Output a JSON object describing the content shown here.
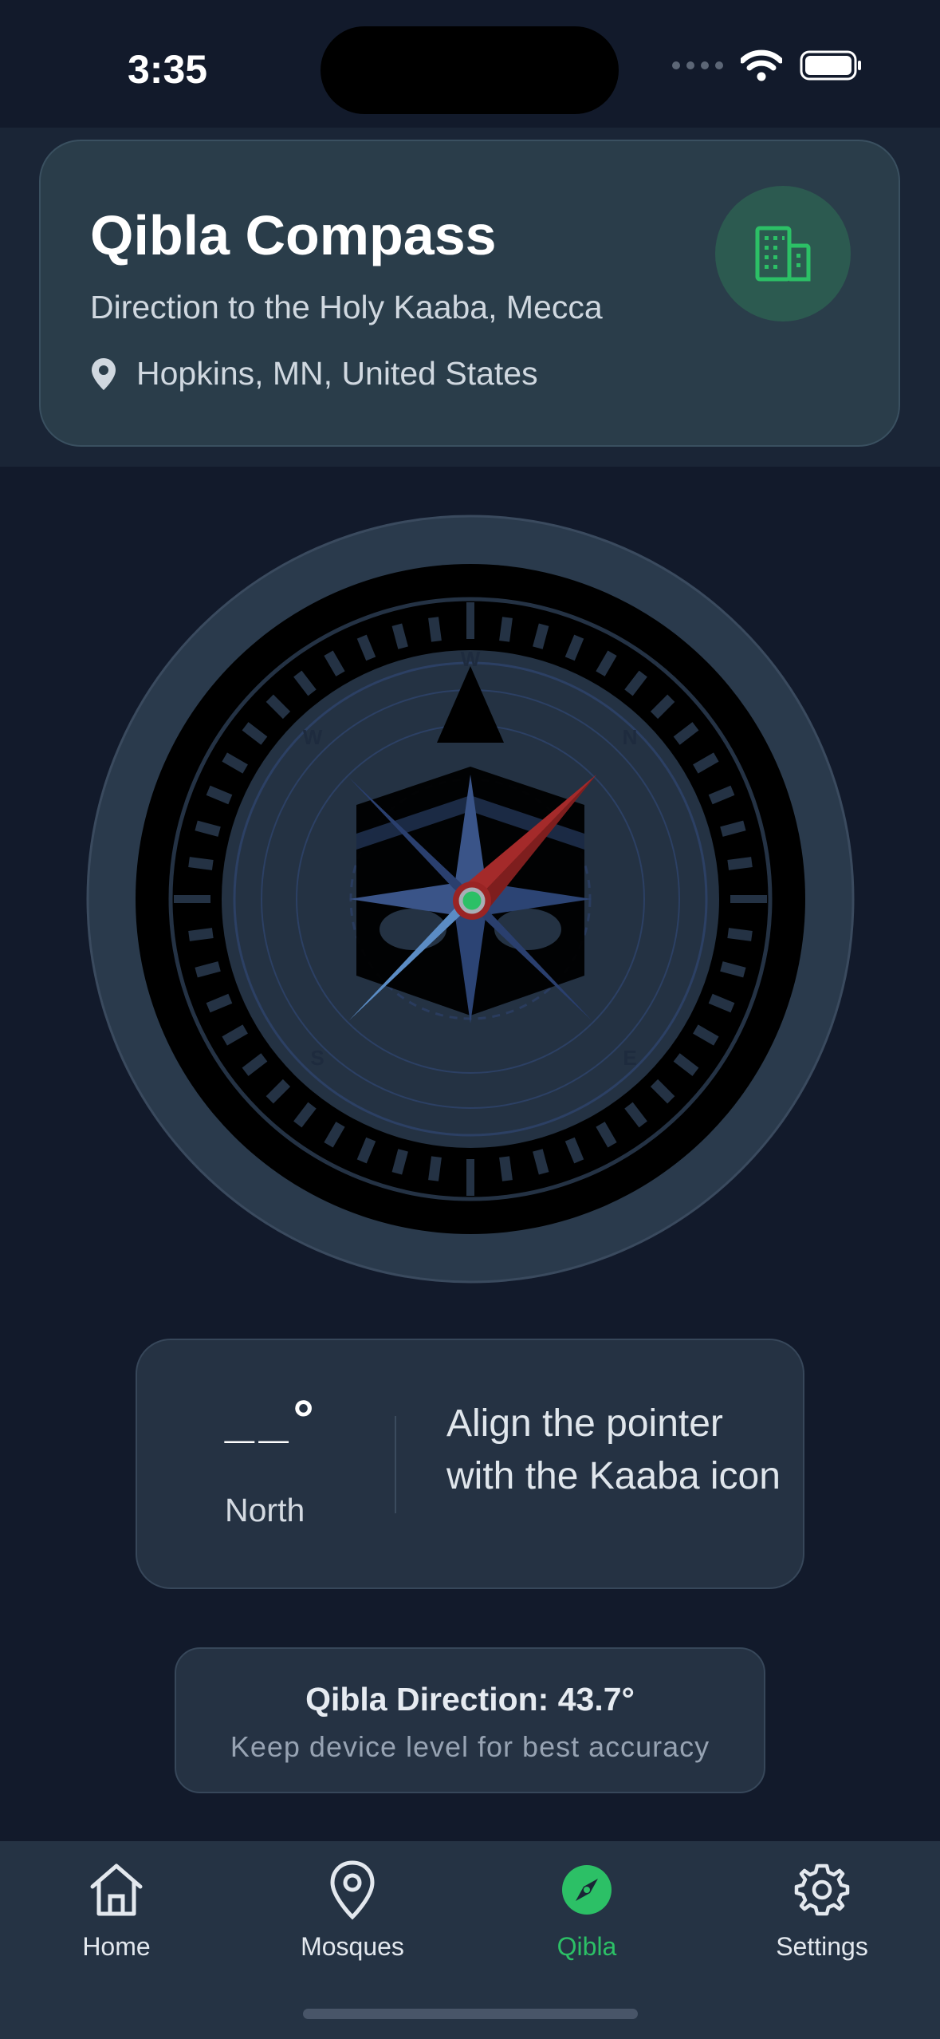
{
  "status_bar": {
    "time": "3:35"
  },
  "header": {
    "title": "Qibla Compass",
    "subtitle": "Direction to the Holy Kaaba, Mecca",
    "location": "Hopkins, MN, United States",
    "badge_icon": "building-icon",
    "accent_color": "#2cc066"
  },
  "compass": {
    "cardinals": {
      "n": "N",
      "e": "E",
      "s": "S",
      "w": "W"
    },
    "needle_color": "#a42a2a",
    "ring_color": "#2a3a4c"
  },
  "info_card": {
    "heading_value": "__°",
    "heading_label": "North",
    "instruction": "Align the pointer with the Kaaba icon"
  },
  "qibla_card": {
    "direction": "Qibla Direction: 43.7°",
    "hint": "Keep device level for best accuracy",
    "bearing_deg": 43.7
  },
  "tabbar": {
    "tabs": [
      {
        "label": "Home",
        "icon": "home-icon"
      },
      {
        "label": "Mosques",
        "icon": "map-pin-icon"
      },
      {
        "label": "Qibla",
        "icon": "compass-icon",
        "active": true
      },
      {
        "label": "Settings",
        "icon": "gear-icon"
      }
    ]
  }
}
